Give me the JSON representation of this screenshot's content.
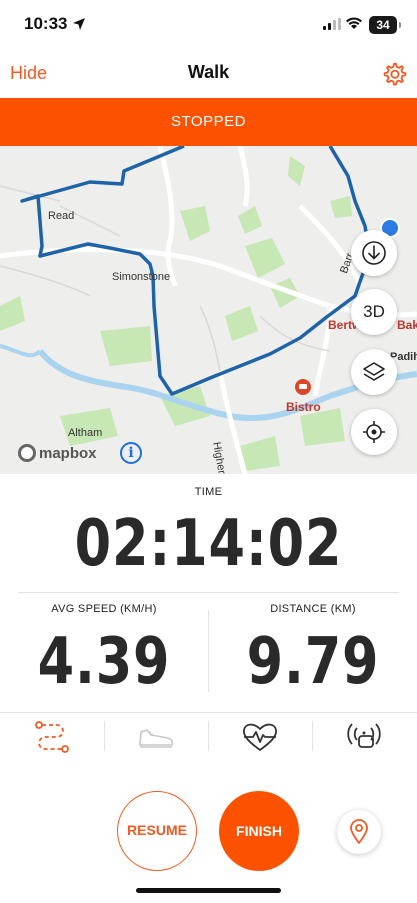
{
  "status_bar": {
    "time": "10:33",
    "battery": "34"
  },
  "nav": {
    "hide_label": "Hide",
    "title": "Walk",
    "settings_icon": "gear-icon"
  },
  "banner": {
    "text": "STOPPED"
  },
  "map": {
    "labels": {
      "read": "Read",
      "simonstone": "Simonstone",
      "altham": "Altham",
      "higher": "Higher Sh",
      "bistro": "Bistro",
      "bertw": "Bertw",
      "bak": "Bak",
      "padih": "Padih",
      "barr": "Barr"
    },
    "attribution": "mapbox",
    "buttons": {
      "download_icon": "download-icon",
      "three_d": "3D",
      "layers_icon": "layers-icon",
      "locate_icon": "locate-icon"
    },
    "colors": {
      "route": "#1e63a8",
      "water": "#a9d3ef",
      "park": "#c7e7b5",
      "background": "#eeeeec"
    }
  },
  "stats": {
    "time": {
      "label": "TIME",
      "value": "02:14:02"
    },
    "avg_speed": {
      "label": "AVG SPEED (KM/H)",
      "value": "4.39"
    },
    "distance": {
      "label": "DISTANCE (KM)",
      "value": "9.79"
    }
  },
  "tabs": [
    {
      "icon": "route-icon",
      "active": true
    },
    {
      "icon": "shoe-icon",
      "active": false
    },
    {
      "icon": "heart-rate-icon",
      "active": false
    },
    {
      "icon": "sensor-icon",
      "active": false
    }
  ],
  "actions": {
    "resume_label": "RESUME",
    "finish_label": "FINISH",
    "pin_icon": "location-pin-icon"
  },
  "colors": {
    "accent": "#fc5200",
    "accent_text": "#f15a22"
  }
}
